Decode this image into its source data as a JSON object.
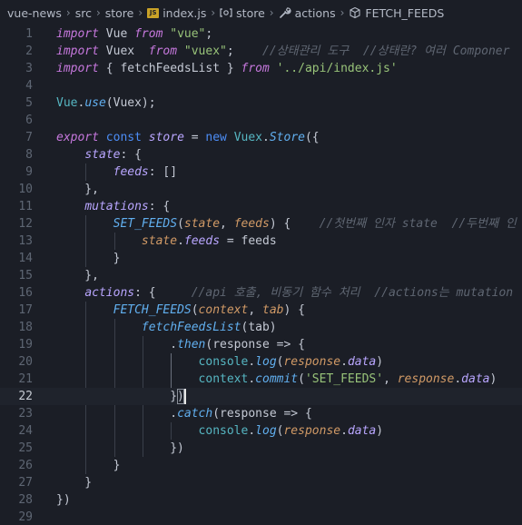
{
  "breadcrumb": {
    "items": [
      {
        "label": "vue-news",
        "icon": ""
      },
      {
        "label": "src",
        "icon": ""
      },
      {
        "label": "store",
        "icon": ""
      },
      {
        "label": "index.js",
        "icon": "js-file-icon"
      },
      {
        "label": "store",
        "icon": "variable-icon"
      },
      {
        "label": "actions",
        "icon": "wrench-icon"
      },
      {
        "label": "FETCH_FEEDS",
        "icon": "cube-icon"
      }
    ],
    "js_badge": "JS"
  },
  "editor": {
    "current_line": 22,
    "lines": [
      [
        [
          "kw",
          "import"
        ],
        [
          "plain",
          " Vue "
        ],
        [
          "kw",
          "from"
        ],
        [
          "plain",
          " "
        ],
        [
          "str",
          "\"vue\""
        ],
        [
          "plain",
          ";"
        ]
      ],
      [
        [
          "kw",
          "import"
        ],
        [
          "plain",
          " Vuex  "
        ],
        [
          "kw",
          "from"
        ],
        [
          "plain",
          " "
        ],
        [
          "str",
          "\"vuex\""
        ],
        [
          "plain",
          ";    "
        ],
        [
          "cm",
          "//상태관리 도구  //상태란? 여러 Componer"
        ]
      ],
      [
        [
          "kw",
          "import"
        ],
        [
          "plain",
          " { fetchFeedsList } "
        ],
        [
          "kw",
          "from"
        ],
        [
          "plain",
          " "
        ],
        [
          "str",
          "'../api/index.js'"
        ]
      ],
      [],
      [
        [
          "cls",
          "Vue"
        ],
        [
          "plain",
          "."
        ],
        [
          "fn",
          "use"
        ],
        [
          "plain",
          "(Vuex);"
        ]
      ],
      [],
      [
        [
          "kw",
          "export"
        ],
        [
          "plain",
          " "
        ],
        [
          "kw2",
          "const"
        ],
        [
          "plain",
          " "
        ],
        [
          "prop",
          "store"
        ],
        [
          "plain",
          " = "
        ],
        [
          "kw2",
          "new"
        ],
        [
          "plain",
          " "
        ],
        [
          "cls",
          "Vuex"
        ],
        [
          "plain",
          "."
        ],
        [
          "fn",
          "Store"
        ],
        [
          "plain",
          "({"
        ]
      ],
      [
        [
          "plain",
          "    "
        ],
        [
          "prop",
          "state"
        ],
        [
          "plain",
          ": {"
        ]
      ],
      [
        [
          "plain",
          "        "
        ],
        [
          "prop",
          "feeds"
        ],
        [
          "plain",
          ": []"
        ]
      ],
      [
        [
          "plain",
          "    },"
        ]
      ],
      [
        [
          "plain",
          "    "
        ],
        [
          "prop",
          "mutations"
        ],
        [
          "plain",
          ": {"
        ]
      ],
      [
        [
          "plain",
          "        "
        ],
        [
          "fn",
          "SET_FEEDS"
        ],
        [
          "plain",
          "("
        ],
        [
          "par",
          "state"
        ],
        [
          "plain",
          ", "
        ],
        [
          "par",
          "feeds"
        ],
        [
          "plain",
          ") {    "
        ],
        [
          "cm",
          "//첫번째 인자 state  //두번째 인"
        ]
      ],
      [
        [
          "plain",
          "            "
        ],
        [
          "par",
          "state"
        ],
        [
          "plain",
          "."
        ],
        [
          "prop",
          "feeds"
        ],
        [
          "plain",
          " = feeds"
        ]
      ],
      [
        [
          "plain",
          "        }"
        ]
      ],
      [
        [
          "plain",
          "    },"
        ]
      ],
      [
        [
          "plain",
          "    "
        ],
        [
          "prop",
          "actions"
        ],
        [
          "plain",
          ": {     "
        ],
        [
          "cm",
          "//api 호출, 비동기 함수 처리  //actions는 mutation"
        ]
      ],
      [
        [
          "plain",
          "        "
        ],
        [
          "fn",
          "FETCH_FEEDS"
        ],
        [
          "plain",
          "("
        ],
        [
          "par",
          "context"
        ],
        [
          "plain",
          ", "
        ],
        [
          "par",
          "tab"
        ],
        [
          "plain",
          ") {"
        ]
      ],
      [
        [
          "plain",
          "            "
        ],
        [
          "fn",
          "fetchFeedsList"
        ],
        [
          "plain",
          "(tab)"
        ]
      ],
      [
        [
          "plain",
          "                ."
        ],
        [
          "fn",
          "then"
        ],
        [
          "plain",
          "(response => {"
        ]
      ],
      [
        [
          "plain",
          "                    "
        ],
        [
          "cls",
          "console"
        ],
        [
          "plain",
          "."
        ],
        [
          "fn",
          "log"
        ],
        [
          "plain",
          "("
        ],
        [
          "par",
          "response"
        ],
        [
          "plain",
          "."
        ],
        [
          "prop",
          "data"
        ],
        [
          "plain",
          ")"
        ]
      ],
      [
        [
          "plain",
          "                    "
        ],
        [
          "cls",
          "context"
        ],
        [
          "plain",
          "."
        ],
        [
          "fn",
          "commit"
        ],
        [
          "plain",
          "("
        ],
        [
          "str",
          "'SET_FEEDS'"
        ],
        [
          "plain",
          ", "
        ],
        [
          "par",
          "response"
        ],
        [
          "plain",
          "."
        ],
        [
          "prop",
          "data"
        ],
        [
          "plain",
          ")"
        ]
      ],
      [
        [
          "plain",
          "                })"
        ]
      ],
      [
        [
          "plain",
          "                ."
        ],
        [
          "fn",
          "catch"
        ],
        [
          "plain",
          "(response => {"
        ]
      ],
      [
        [
          "plain",
          "                    "
        ],
        [
          "cls",
          "console"
        ],
        [
          "plain",
          "."
        ],
        [
          "fn",
          "log"
        ],
        [
          "plain",
          "("
        ],
        [
          "par",
          "response"
        ],
        [
          "plain",
          "."
        ],
        [
          "prop",
          "data"
        ],
        [
          "plain",
          ")"
        ]
      ],
      [
        [
          "plain",
          "                })"
        ]
      ],
      [
        [
          "plain",
          "        }"
        ]
      ],
      [
        [
          "plain",
          "    }"
        ]
      ],
      [
        [
          "plain",
          "})"
        ]
      ],
      []
    ]
  }
}
